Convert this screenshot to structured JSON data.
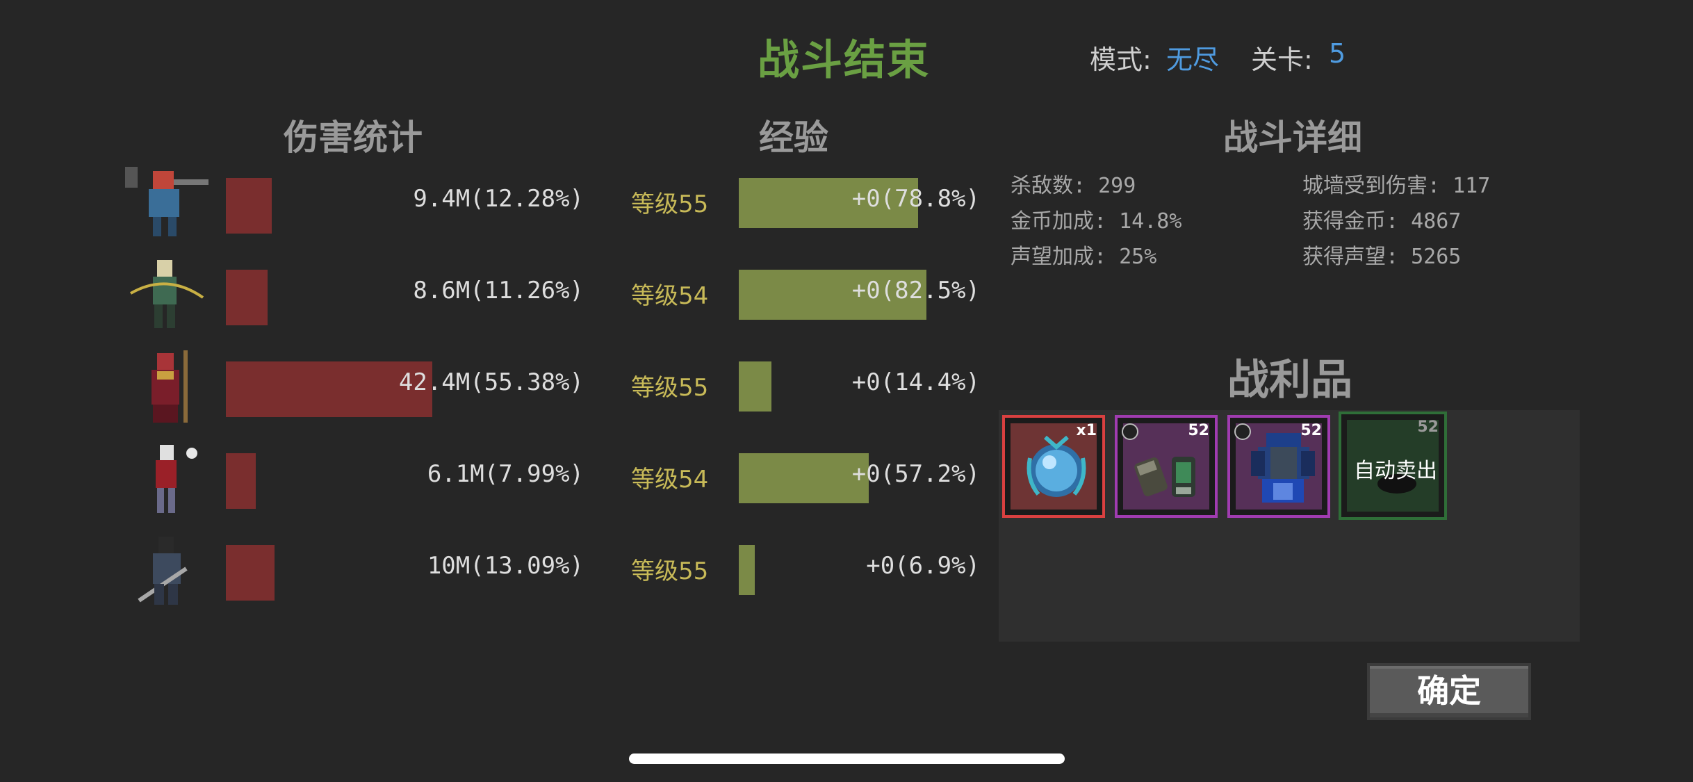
{
  "header": {
    "title": "战斗结束",
    "mode_label": "模式:",
    "mode_value": "无尽",
    "stage_label": "关卡:",
    "stage_value": "5"
  },
  "sections": {
    "damage": "伤害统计",
    "xp": "经验",
    "details": "战斗详细",
    "loot": "战利品"
  },
  "heroes": [
    {
      "portrait": "gunner-dwarf-icon",
      "damage_text": "9.4M(12.28%)",
      "damage_pct": 12.28,
      "level_text": "等级55",
      "xp_text": "+0(78.8%)",
      "xp_pct": 78.8
    },
    {
      "portrait": "elf-archer-icon",
      "damage_text": "8.6M(11.26%)",
      "damage_pct": 11.26,
      "level_text": "等级54",
      "xp_text": "+0(82.5%)",
      "xp_pct": 82.5
    },
    {
      "portrait": "mage-staff-icon",
      "damage_text": "42.4M(55.38%)",
      "damage_pct": 55.38,
      "level_text": "等级55",
      "xp_text": "+0(14.4%)",
      "xp_pct": 14.4
    },
    {
      "portrait": "vampire-icon",
      "damage_text": "6.1M(7.99%)",
      "damage_pct": 7.99,
      "level_text": "等级54",
      "xp_text": "+0(57.2%)",
      "xp_pct": 57.2
    },
    {
      "portrait": "swordsman-icon",
      "damage_text": "10M(13.09%)",
      "damage_pct": 13.09,
      "level_text": "等级55",
      "xp_text": "+0(6.9%)",
      "xp_pct": 6.9
    }
  ],
  "details": {
    "kills": "杀敌数: 299",
    "wall_damage": "城墙受到伤害: 117",
    "gold_bonus": "金币加成: 14.8%",
    "gold_gained": "获得金币: 4867",
    "fame_bonus": "声望加成: 25%",
    "fame_gained": "获得声望: 5265"
  },
  "loot": [
    {
      "icon": "blue-orb-icon",
      "count": "x1",
      "border": "#d94040",
      "bg": "#6e3434"
    },
    {
      "icon": "gauntlets-icon",
      "count": "52",
      "border": "#a03cb0",
      "bg": "#563058"
    },
    {
      "icon": "blue-armor-icon",
      "count": "52",
      "border": "#a03cb0",
      "bg": "#563058"
    },
    {
      "icon": "black-item-icon",
      "count": "52",
      "border": "#2f6e38",
      "bg": "#243d28",
      "overlay": "自动卖出"
    }
  ],
  "confirm_label": "确定",
  "colors": {
    "damage_bar": "#7a2e2e",
    "xp_bar": "#7b8a47",
    "title": "#6aa043",
    "accent": "#4f9be0",
    "level": "#c8ba58"
  }
}
